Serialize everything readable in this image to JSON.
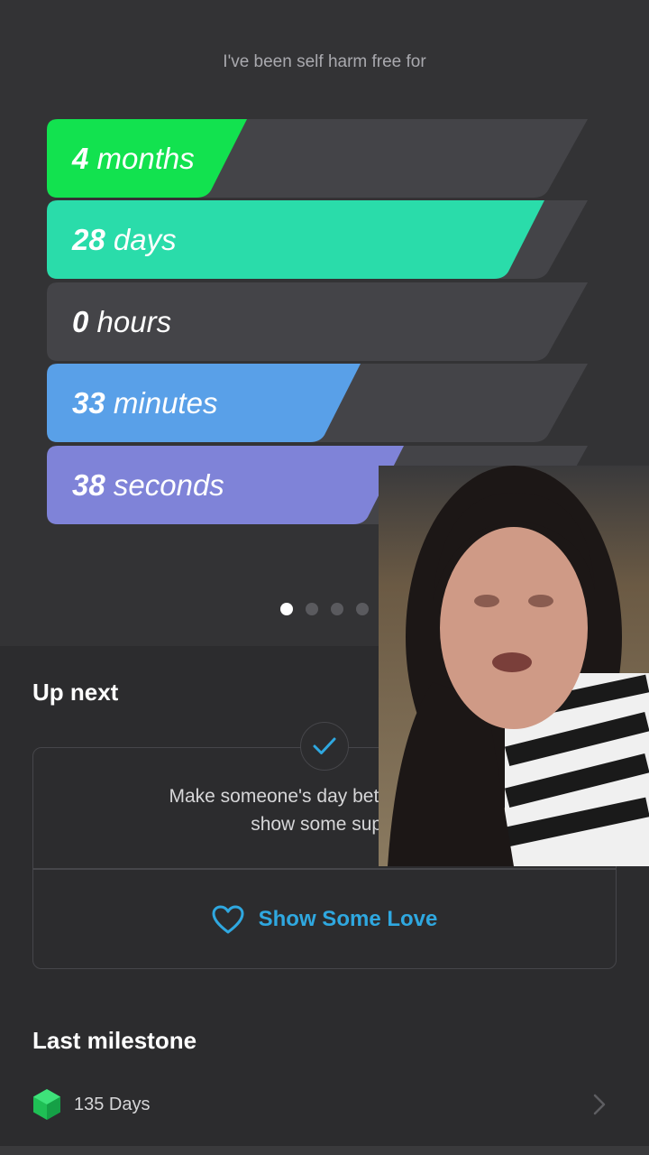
{
  "header": {
    "text": "I've been self harm free for"
  },
  "counters": [
    {
      "value": "4",
      "unit": "months",
      "fill_fraction": 0.37,
      "color": "#12e24f"
    },
    {
      "value": "28",
      "unit": "days",
      "fill_fraction": 0.92,
      "color": "#2adcaa"
    },
    {
      "value": "0",
      "unit": "hours",
      "fill_fraction": 0.0,
      "color": "#444448"
    },
    {
      "value": "33",
      "unit": "minutes",
      "fill_fraction": 0.58,
      "color": "#59a0e8"
    },
    {
      "value": "38",
      "unit": "seconds",
      "fill_fraction": 0.66,
      "color": "#7f83d8"
    }
  ],
  "pager": {
    "count": 4,
    "active": 1
  },
  "up_next": {
    "title": "Up next",
    "message_line1": "Make someone's day better! Add a c",
    "message_line2": "show some supp",
    "button_label": "Show Some Love",
    "button_icon": "heart-icon",
    "accent": "#2fa8e0"
  },
  "last_milestone": {
    "title": "Last milestone",
    "label": "135 Days",
    "icon": "gem-icon",
    "chevron": "chevron-right-icon"
  }
}
